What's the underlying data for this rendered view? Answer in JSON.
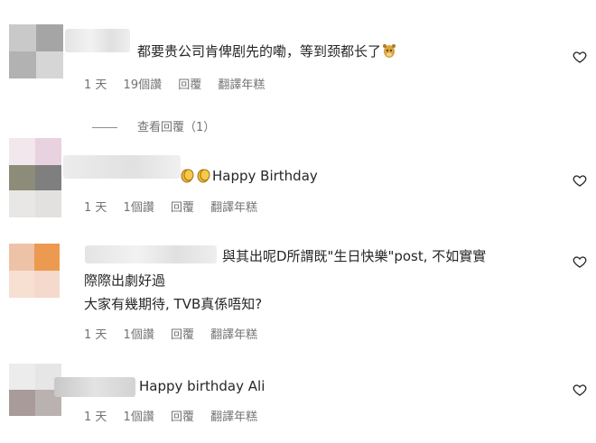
{
  "comments": [
    {
      "text": "都要贵公司肯俾剧先的嘞，等到颈都长了",
      "emoji": "giraffe-emoji",
      "time": "1 天",
      "likes": "19個讚",
      "reply": "回覆",
      "translate": "翻譯年糕",
      "view_replies": "查看回覆（1）"
    },
    {
      "text": "Happy Birthday",
      "emoji": "clapping-hands-emoji",
      "time": "1 天",
      "likes": "1個讚",
      "reply": "回覆",
      "translate": "翻譯年糕"
    },
    {
      "text_line1": "與其出呢D所謂既\"生日快樂\"post, 不如實實",
      "text_line2": "際際出劇好過",
      "text_line3": "大家有幾期待, TVB真係唔知?",
      "time": "1 天",
      "likes": "1個讚",
      "reply": "回覆",
      "translate": "翻譯年糕"
    },
    {
      "text": "Happy birthday Ali",
      "time": "1 天",
      "likes": "1個讚",
      "reply": "回覆",
      "translate": "翻譯年糕"
    }
  ],
  "colors": {
    "text": "#262626",
    "meta": "#737373"
  }
}
